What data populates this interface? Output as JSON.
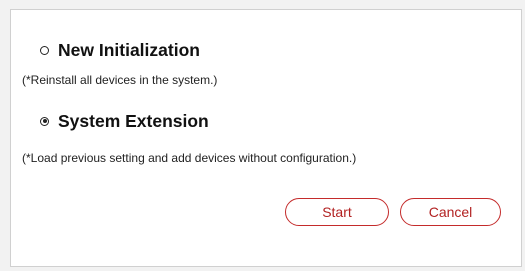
{
  "options": [
    {
      "label": "New Initialization",
      "checked": false
    },
    {
      "label": "System Extension",
      "checked": true
    }
  ],
  "notes": [
    "(*Reinstall all devices in the system.)",
    "(*Load previous setting and add devices without configuration.)"
  ],
  "buttons": {
    "start_label": "Start",
    "cancel_label": "Cancel"
  },
  "colors": {
    "button_accent": "#c42b2b",
    "button_text": "#b22222",
    "background": "#f2f2f2",
    "panel": "#ffffff"
  }
}
